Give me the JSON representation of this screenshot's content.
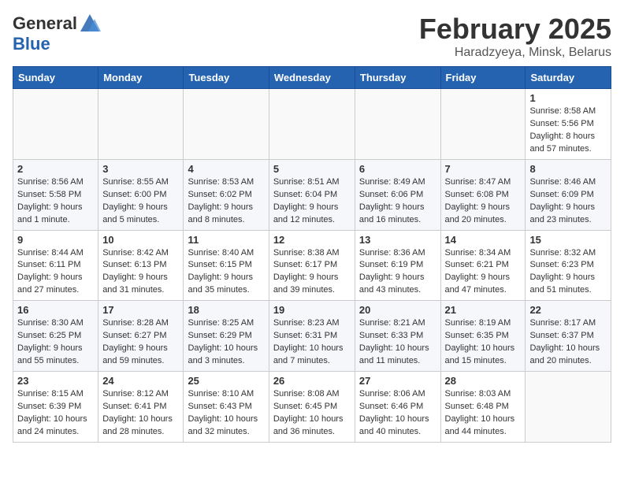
{
  "header": {
    "logo_general": "General",
    "logo_blue": "Blue",
    "month_title": "February 2025",
    "subtitle": "Haradzyeya, Minsk, Belarus"
  },
  "weekdays": [
    "Sunday",
    "Monday",
    "Tuesday",
    "Wednesday",
    "Thursday",
    "Friday",
    "Saturday"
  ],
  "weeks": [
    [
      {
        "day": "",
        "info": ""
      },
      {
        "day": "",
        "info": ""
      },
      {
        "day": "",
        "info": ""
      },
      {
        "day": "",
        "info": ""
      },
      {
        "day": "",
        "info": ""
      },
      {
        "day": "",
        "info": ""
      },
      {
        "day": "1",
        "info": "Sunrise: 8:58 AM\nSunset: 5:56 PM\nDaylight: 8 hours\nand 57 minutes."
      }
    ],
    [
      {
        "day": "2",
        "info": "Sunrise: 8:56 AM\nSunset: 5:58 PM\nDaylight: 9 hours\nand 1 minute."
      },
      {
        "day": "3",
        "info": "Sunrise: 8:55 AM\nSunset: 6:00 PM\nDaylight: 9 hours\nand 5 minutes."
      },
      {
        "day": "4",
        "info": "Sunrise: 8:53 AM\nSunset: 6:02 PM\nDaylight: 9 hours\nand 8 minutes."
      },
      {
        "day": "5",
        "info": "Sunrise: 8:51 AM\nSunset: 6:04 PM\nDaylight: 9 hours\nand 12 minutes."
      },
      {
        "day": "6",
        "info": "Sunrise: 8:49 AM\nSunset: 6:06 PM\nDaylight: 9 hours\nand 16 minutes."
      },
      {
        "day": "7",
        "info": "Sunrise: 8:47 AM\nSunset: 6:08 PM\nDaylight: 9 hours\nand 20 minutes."
      },
      {
        "day": "8",
        "info": "Sunrise: 8:46 AM\nSunset: 6:09 PM\nDaylight: 9 hours\nand 23 minutes."
      }
    ],
    [
      {
        "day": "9",
        "info": "Sunrise: 8:44 AM\nSunset: 6:11 PM\nDaylight: 9 hours\nand 27 minutes."
      },
      {
        "day": "10",
        "info": "Sunrise: 8:42 AM\nSunset: 6:13 PM\nDaylight: 9 hours\nand 31 minutes."
      },
      {
        "day": "11",
        "info": "Sunrise: 8:40 AM\nSunset: 6:15 PM\nDaylight: 9 hours\nand 35 minutes."
      },
      {
        "day": "12",
        "info": "Sunrise: 8:38 AM\nSunset: 6:17 PM\nDaylight: 9 hours\nand 39 minutes."
      },
      {
        "day": "13",
        "info": "Sunrise: 8:36 AM\nSunset: 6:19 PM\nDaylight: 9 hours\nand 43 minutes."
      },
      {
        "day": "14",
        "info": "Sunrise: 8:34 AM\nSunset: 6:21 PM\nDaylight: 9 hours\nand 47 minutes."
      },
      {
        "day": "15",
        "info": "Sunrise: 8:32 AM\nSunset: 6:23 PM\nDaylight: 9 hours\nand 51 minutes."
      }
    ],
    [
      {
        "day": "16",
        "info": "Sunrise: 8:30 AM\nSunset: 6:25 PM\nDaylight: 9 hours\nand 55 minutes."
      },
      {
        "day": "17",
        "info": "Sunrise: 8:28 AM\nSunset: 6:27 PM\nDaylight: 9 hours\nand 59 minutes."
      },
      {
        "day": "18",
        "info": "Sunrise: 8:25 AM\nSunset: 6:29 PM\nDaylight: 10 hours\nand 3 minutes."
      },
      {
        "day": "19",
        "info": "Sunrise: 8:23 AM\nSunset: 6:31 PM\nDaylight: 10 hours\nand 7 minutes."
      },
      {
        "day": "20",
        "info": "Sunrise: 8:21 AM\nSunset: 6:33 PM\nDaylight: 10 hours\nand 11 minutes."
      },
      {
        "day": "21",
        "info": "Sunrise: 8:19 AM\nSunset: 6:35 PM\nDaylight: 10 hours\nand 15 minutes."
      },
      {
        "day": "22",
        "info": "Sunrise: 8:17 AM\nSunset: 6:37 PM\nDaylight: 10 hours\nand 20 minutes."
      }
    ],
    [
      {
        "day": "23",
        "info": "Sunrise: 8:15 AM\nSunset: 6:39 PM\nDaylight: 10 hours\nand 24 minutes."
      },
      {
        "day": "24",
        "info": "Sunrise: 8:12 AM\nSunset: 6:41 PM\nDaylight: 10 hours\nand 28 minutes."
      },
      {
        "day": "25",
        "info": "Sunrise: 8:10 AM\nSunset: 6:43 PM\nDaylight: 10 hours\nand 32 minutes."
      },
      {
        "day": "26",
        "info": "Sunrise: 8:08 AM\nSunset: 6:45 PM\nDaylight: 10 hours\nand 36 minutes."
      },
      {
        "day": "27",
        "info": "Sunrise: 8:06 AM\nSunset: 6:46 PM\nDaylight: 10 hours\nand 40 minutes."
      },
      {
        "day": "28",
        "info": "Sunrise: 8:03 AM\nSunset: 6:48 PM\nDaylight: 10 hours\nand 44 minutes."
      },
      {
        "day": "",
        "info": ""
      }
    ]
  ]
}
